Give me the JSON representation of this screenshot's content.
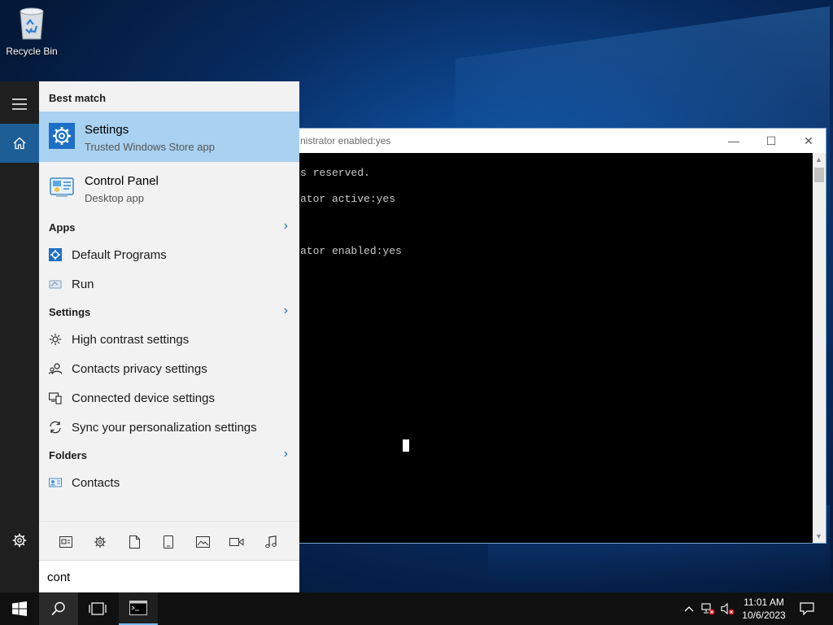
{
  "desktop": {
    "recycle_bin_label": "Recycle Bin"
  },
  "cmd_window": {
    "title": "nistrator enabled:yes",
    "lines": [
      "s reserved.",
      "ator active:yes",
      "ator enabled:yes"
    ],
    "minimize": "—",
    "maximize": "☐",
    "close": "✕"
  },
  "search_panel": {
    "best_match_header": "Best match",
    "best_match": {
      "name": "Settings",
      "subtitle": "Trusted Windows Store app",
      "icon": "gear-icon"
    },
    "second_match": {
      "name": "Control Panel",
      "subtitle": "Desktop app",
      "icon": "control-panel-icon"
    },
    "apps_header": "Apps",
    "apps": [
      {
        "label": "Default Programs",
        "icon": "gear-icon"
      },
      {
        "label": "Run",
        "icon": "run-icon"
      }
    ],
    "settings_header": "Settings",
    "settings": [
      {
        "label": "High contrast settings",
        "icon": "sun-icon"
      },
      {
        "label": "Contacts privacy settings",
        "icon": "people-icon"
      },
      {
        "label": "Connected device settings",
        "icon": "devices-icon"
      },
      {
        "label": "Sync your personalization settings",
        "icon": "sync-icon"
      }
    ],
    "folders_header": "Folders",
    "folders": [
      {
        "label": "Contacts",
        "icon": "contact-card-icon"
      }
    ],
    "filters": [
      "apps-filter-icon",
      "settings-filter-icon",
      "documents-filter-icon",
      "device-filter-icon",
      "photos-filter-icon",
      "videos-filter-icon",
      "music-filter-icon"
    ],
    "search_value": "cont"
  },
  "taskbar": {
    "time": "11:01 AM",
    "date": "10/6/2023"
  },
  "colors": {
    "best_match_bg": "#a9d1f0",
    "accent": "#1a6fc4",
    "home_rail": "#1d5e96"
  }
}
